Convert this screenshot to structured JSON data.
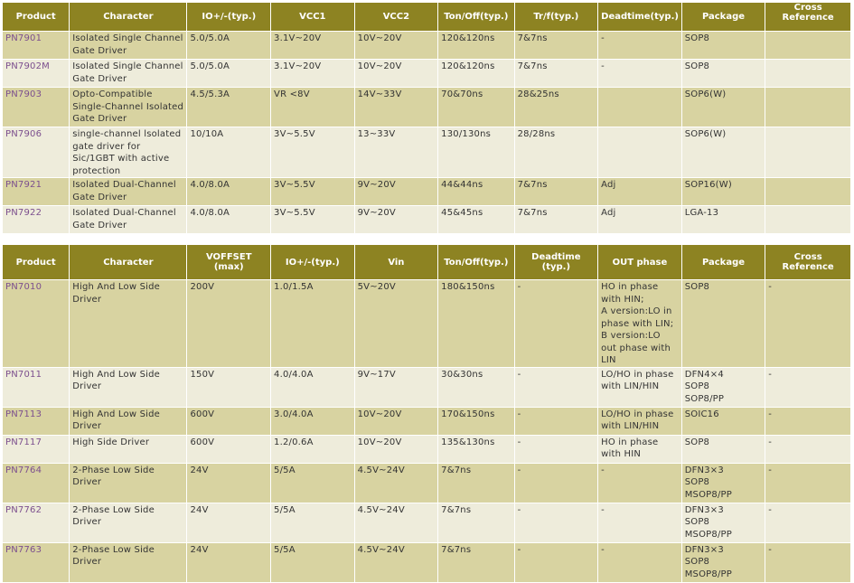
{
  "table1": {
    "headers": [
      "Product",
      "Character",
      "IO+/-(typ.)",
      "VCC1",
      "VCC2",
      "Ton/Off(typ.)",
      "Tr/f(typ.)",
      "Deadtime(typ.)",
      "Package",
      "Cross Reference"
    ],
    "rows": [
      [
        "PN7901",
        "Isolated Single Channel Gate Driver",
        "5.0/5.0A",
        "3.1V~20V",
        "10V~20V",
        "120&120ns",
        "7&7ns",
        "-",
        "SOP8",
        ""
      ],
      [
        "PN7902M",
        "Isolated Single Channel Gate Driver",
        "5.0/5.0A",
        "3.1V~20V",
        "10V~20V",
        "120&120ns",
        "7&7ns",
        "-",
        "SOP8",
        ""
      ],
      [
        "PN7903",
        "Opto-Compatible Single-Channel Isolated Gate Driver",
        "4.5/5.3A",
        "VR <8V",
        "14V~33V",
        "70&70ns",
        "28&25ns",
        "",
        "SOP6(W)",
        ""
      ],
      [
        "PN7906",
        "single-channel lsolated gate driver for Sic/1GBT with active protection",
        "10/10A",
        "3V~5.5V",
        "13~33V",
        "130/130ns",
        "28/28ns",
        "",
        "SOP6(W)",
        ""
      ],
      [
        "PN7921",
        "Isolated Dual-Channel Gate Driver",
        "4.0/8.0A",
        "3V~5.5V",
        "9V~20V",
        "44&44ns",
        "7&7ns",
        "Adj",
        "SOP16(W)",
        ""
      ],
      [
        "PN7922",
        "Isolated Dual-Channel Gate Driver",
        "4.0/8.0A",
        "3V~5.5V",
        "9V~20V",
        "45&45ns",
        "7&7ns",
        "Adj",
        "LGA-13",
        ""
      ]
    ]
  },
  "table2": {
    "headers": [
      "Product",
      "Character",
      "VOFFSET (max)",
      "IO+/-(typ.)",
      "Vin",
      "Ton/Off(typ.)",
      "Deadtime (typ.)",
      "OUT phase",
      "Package",
      "Cross Reference"
    ],
    "rows": [
      [
        "PN7010",
        "High And Low Side Driver",
        "200V",
        "1.0/1.5A",
        "5V~20V",
        "180&150ns",
        "-",
        "HO in phase with HIN;\nA version:LO in phase with LIN;\nB version:LO out phase with LIN",
        "SOP8",
        "-"
      ],
      [
        "PN7011",
        "High And Low Side Driver",
        "150V",
        "4.0/4.0A",
        "9V~17V",
        "30&30ns",
        "-",
        "LO/HO in phase with LIN/HIN",
        "DFN4×4\nSOP8\nSOP8/PP",
        "-"
      ],
      [
        "PN7113",
        "High And Low Side Driver",
        "600V",
        "3.0/4.0A",
        "10V~20V",
        "170&150ns",
        "-",
        "LO/HO in phase with LIN/HIN",
        "SOIC16",
        "-"
      ],
      [
        "PN7117",
        "High  Side Driver",
        "600V",
        "1.2/0.6A",
        "10V~20V",
        "135&130ns",
        "-",
        "HO in phase with HIN",
        "SOP8",
        "-"
      ],
      [
        "PN7764",
        "2-Phase Low Side Driver",
        "24V",
        "5/5A",
        "4.5V~24V",
        "7&7ns",
        "-",
        "-",
        "DFN3×3\nSOP8\nMSOP8/PP",
        "-"
      ],
      [
        "PN7762",
        "2-Phase Low Side Driver",
        "24V",
        "5/5A",
        "4.5V~24V",
        "7&7ns",
        "-",
        "-",
        "DFN3×3\nSOP8\nMSOP8/PP",
        "-"
      ],
      [
        "PN7763",
        "2-Phase Low Side Driver",
        "24V",
        "5/5A",
        "4.5V~24V",
        "7&7ns",
        "-",
        "-",
        "DFN3×3\nSOP8\nMSOP8/PP",
        "-"
      ]
    ]
  }
}
